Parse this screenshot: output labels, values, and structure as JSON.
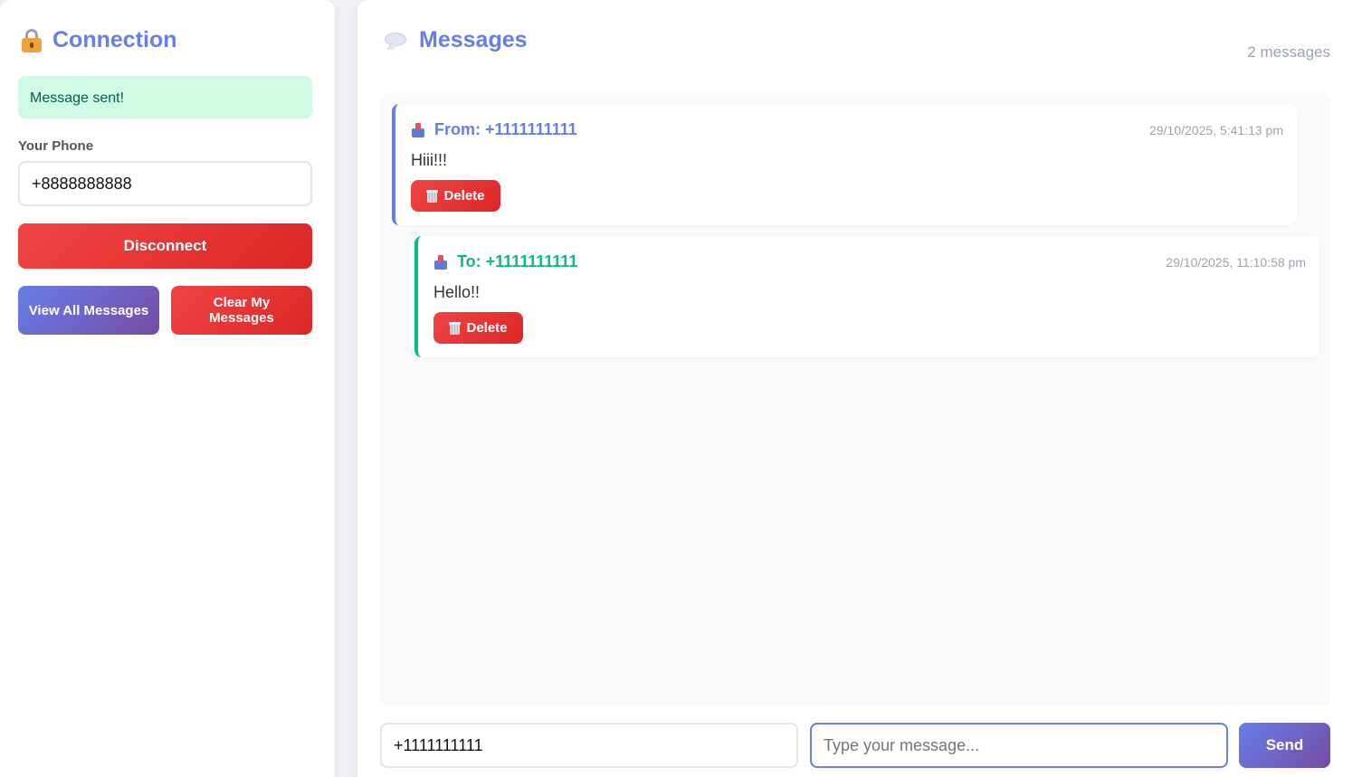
{
  "connection": {
    "title": "Connection",
    "icon": "lock-icon",
    "alert": "Message sent!",
    "phone_label": "Your Phone",
    "phone_value": "+8888888888",
    "disconnect_label": "Disconnect",
    "view_all_label": "View All Messages",
    "clear_label": "Clear My Messages"
  },
  "messages": {
    "title": "Messages",
    "icon": "speech-bubble-icon",
    "count_text": "2 messages",
    "items": [
      {
        "direction": "received",
        "header": "From: +1111111111",
        "time": "29/10/2025, 5:41:13 pm",
        "text": "Hiii!!!",
        "delete_label": "Delete",
        "accent": "#667eea"
      },
      {
        "direction": "sent",
        "header": "To: +1111111111",
        "time": "29/10/2025, 11:10:58 pm",
        "text": "Hello!!",
        "delete_label": "Delete",
        "accent": "#10b981"
      }
    ]
  },
  "composer": {
    "recipient_value": "+1111111111",
    "message_placeholder": "Type your message...",
    "send_label": "Send"
  },
  "colors": {
    "primary": "#667eea",
    "danger": "#ef4444",
    "success_bg": "#d1fae5",
    "sent_accent": "#10b981"
  }
}
